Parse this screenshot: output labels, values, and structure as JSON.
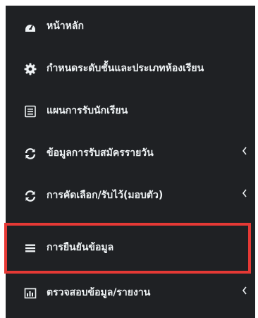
{
  "sidebar": {
    "items": [
      {
        "label": "หน้าหลัก",
        "icon": "dashboard-icon",
        "has_submenu": false
      },
      {
        "label": "กำหนดระดับชั้นและประเภทห้องเรียน",
        "icon": "gear-icon",
        "has_submenu": false
      },
      {
        "label": "แผนการรับนักเรียน",
        "icon": "document-icon",
        "has_submenu": false
      },
      {
        "label": "ข้อมูลการรับสมัครรายวัน",
        "icon": "refresh-icon",
        "has_submenu": true
      },
      {
        "label": "การคัดเลือก/รับไว้(มอบตัว)",
        "icon": "refresh-icon",
        "has_submenu": true
      },
      {
        "label": "การยืนยันข้อมูล",
        "icon": "list-icon",
        "has_submenu": false,
        "highlighted": true
      },
      {
        "label": "ตรวจสอบข้อมูล/รายงาน",
        "icon": "bar-chart-icon",
        "has_submenu": true
      }
    ]
  },
  "colors": {
    "sidebar_bg": "#1f2124",
    "text": "#eef2f4",
    "highlight_border": "#e53935"
  }
}
